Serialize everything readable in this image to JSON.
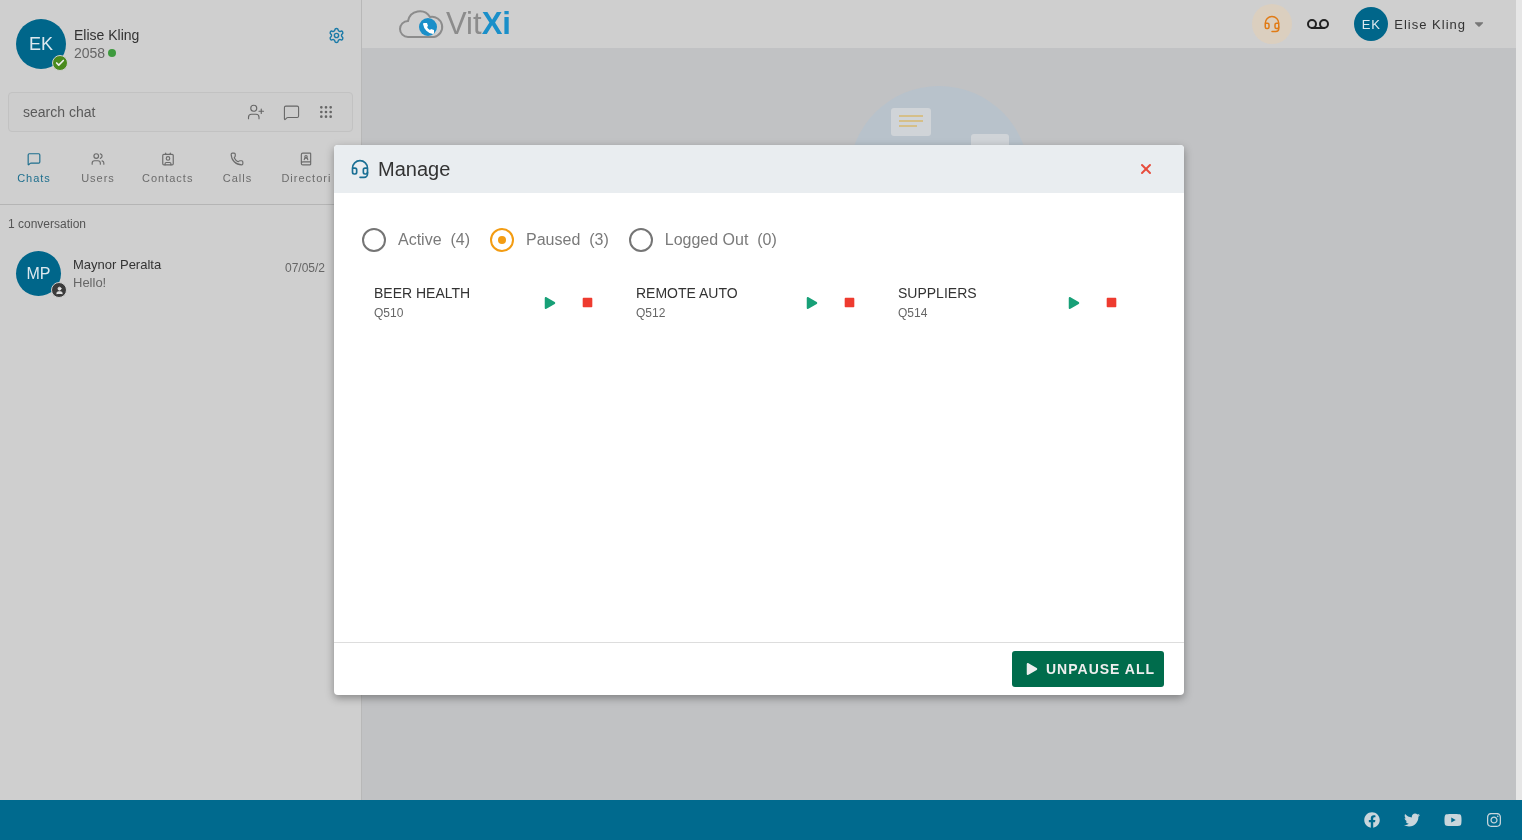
{
  "user": {
    "initials": "EK",
    "name": "Elise Kling",
    "extension": "2058",
    "online": true,
    "verified": true
  },
  "search": {
    "placeholder": "search chat"
  },
  "nav_tabs": [
    {
      "label": "Chats",
      "kind": "chat",
      "selected": true
    },
    {
      "label": "Users",
      "kind": "users",
      "selected": false
    },
    {
      "label": "Contacts",
      "kind": "contacts",
      "selected": false
    },
    {
      "label": "Calls",
      "kind": "calls",
      "selected": false
    },
    {
      "label": "Directori",
      "kind": "directory",
      "selected": false
    }
  ],
  "conversation_count": "1 conversation",
  "conversations": [
    {
      "initials": "MP",
      "name": "Maynor Peralta",
      "message": "Hello!",
      "date": "07/05/2"
    }
  ],
  "top_bar": {
    "logo": [
      "Vit",
      "Xi"
    ],
    "user_initials": "EK",
    "user_name": "Elise Kling"
  },
  "modal": {
    "title": "Manage",
    "filters": [
      {
        "label": "Active",
        "count": "(4)",
        "selected": false
      },
      {
        "label": "Paused",
        "count": "(3)",
        "selected": true
      },
      {
        "label": "Logged Out",
        "count": "(0)",
        "selected": false
      }
    ],
    "queues": [
      {
        "name": "BEER HEALTH",
        "code": "Q510"
      },
      {
        "name": "REMOTE AUTO",
        "code": "Q512"
      },
      {
        "name": "SUPPLIERS",
        "code": "Q514"
      }
    ],
    "action": "UNPAUSE ALL"
  }
}
